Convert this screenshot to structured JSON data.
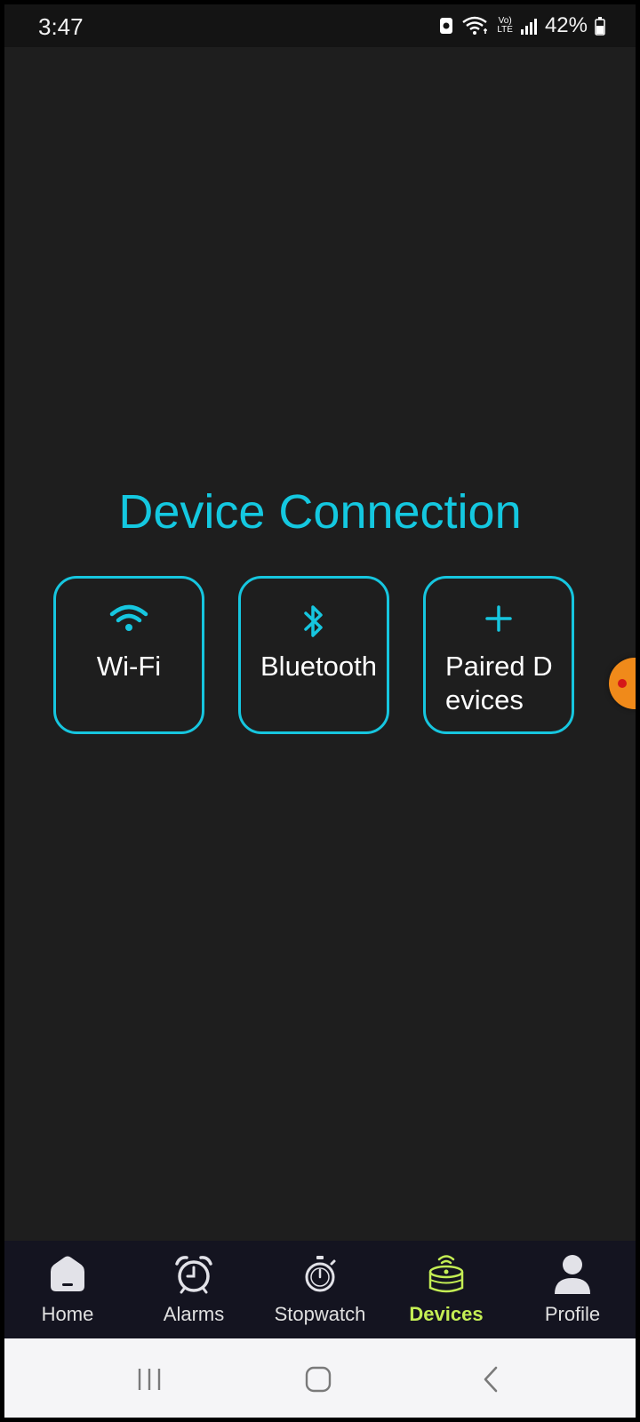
{
  "status": {
    "time": "3:47",
    "battery_percent": "42%",
    "icons": [
      "data-saver-icon",
      "wifi-icon",
      "volte-icon",
      "signal-icon",
      "battery-icon"
    ],
    "volte_label_top": "Vo)",
    "volte_label_bottom": "LTE"
  },
  "page": {
    "title": "Device Connection"
  },
  "cards": {
    "wifi": {
      "label": "Wi-Fi",
      "icon": "wifi-icon"
    },
    "bluetooth": {
      "label": "Bluetooth",
      "icon": "bluetooth-icon"
    },
    "paired": {
      "label": "Paired Devices",
      "icon": "plus-icon"
    }
  },
  "nav": {
    "items": [
      {
        "label": "Home",
        "icon": "home-icon",
        "active": false
      },
      {
        "label": "Alarms",
        "icon": "alarm-clock-icon",
        "active": false
      },
      {
        "label": "Stopwatch",
        "icon": "stopwatch-icon",
        "active": false
      },
      {
        "label": "Devices",
        "icon": "devices-icon",
        "active": true
      },
      {
        "label": "Profile",
        "icon": "profile-icon",
        "active": false
      }
    ]
  },
  "colors": {
    "accent": "#14c8e0",
    "active_nav": "#c4ee54",
    "background": "#1e1e1e",
    "bubble": "#f08a1a"
  }
}
